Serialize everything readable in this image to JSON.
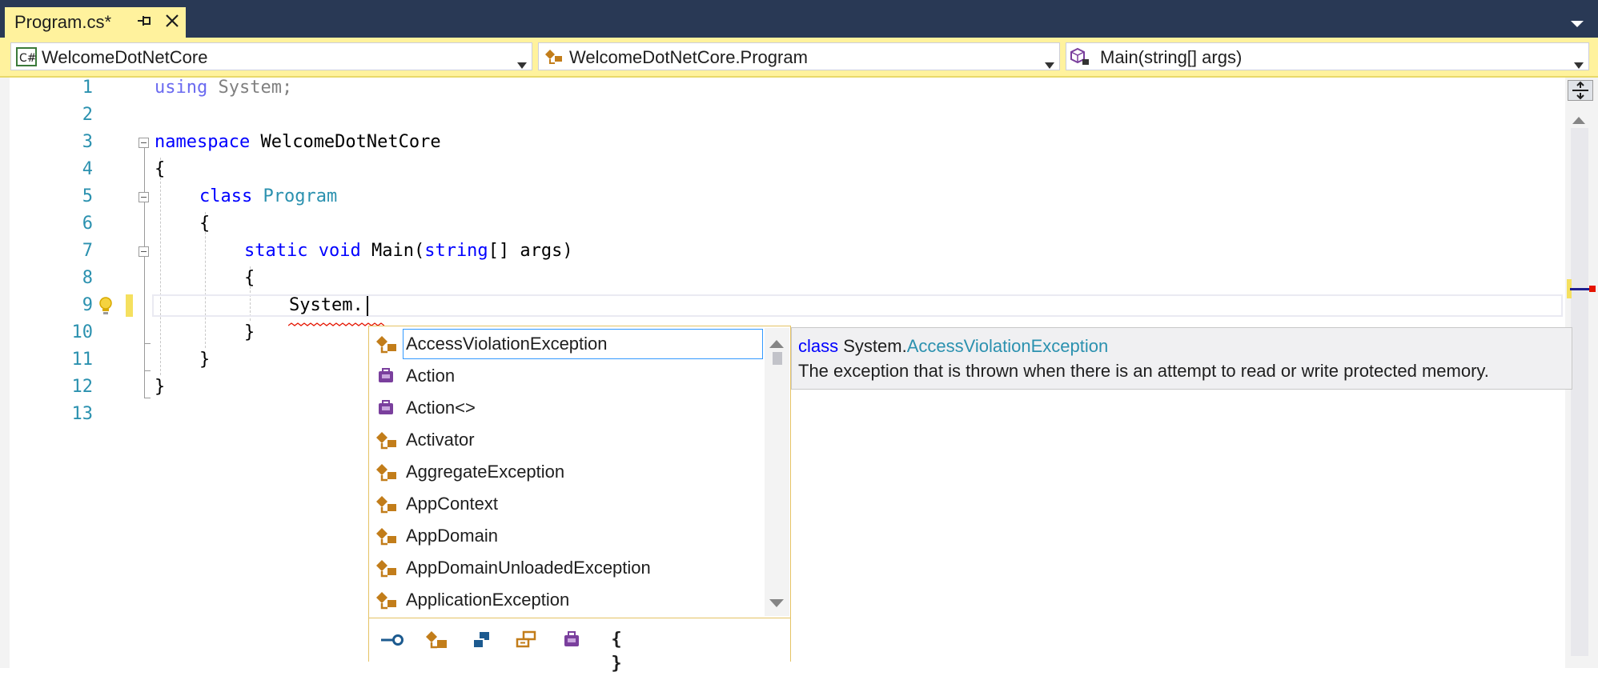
{
  "tab": {
    "title": "Program.cs*",
    "pin_icon": "pin-icon",
    "close_icon": "close-icon"
  },
  "navbar": {
    "project": "WelcomeDotNetCore",
    "type": "WelcomeDotNetCore.Program",
    "member": "Main(string[] args)"
  },
  "code": {
    "line_numbers": [
      "1",
      "2",
      "3",
      "4",
      "5",
      "6",
      "7",
      "8",
      "9",
      "10",
      "11",
      "12",
      "13"
    ],
    "l1_kw": "using",
    "l1_rest": " System;",
    "l3_kw": "namespace",
    "l3_rest": " WelcomeDotNetCore",
    "brace_open": "{",
    "brace_close": "}",
    "l5_kw": "class",
    "l5_type": "Program",
    "l7_kw1": "static",
    "l7_kw2": "void",
    "l7_name": " Main(",
    "l7_kw3": "string",
    "l7_rest": "[] args)",
    "l9_text": "System."
  },
  "completion": {
    "items": [
      {
        "label": "AccessViolationException",
        "icon": "class-icon"
      },
      {
        "label": "Action",
        "icon": "delegate-icon"
      },
      {
        "label": "Action<>",
        "icon": "delegate-icon"
      },
      {
        "label": "Activator",
        "icon": "class-icon"
      },
      {
        "label": "AggregateException",
        "icon": "class-icon"
      },
      {
        "label": "AppContext",
        "icon": "class-icon"
      },
      {
        "label": "AppDomain",
        "icon": "class-icon"
      },
      {
        "label": "AppDomainUnloadedException",
        "icon": "class-icon"
      },
      {
        "label": "ApplicationException",
        "icon": "class-icon"
      }
    ],
    "selected_index": 0,
    "filters": [
      "interface-filter-icon",
      "class-filter-icon",
      "structure-filter-icon",
      "enum-filter-icon",
      "delegate-filter-icon",
      "namespace-filter-icon"
    ],
    "namespace_filter_glyph": "{ }"
  },
  "quickinfo": {
    "kind": "class",
    "namespace": "System.",
    "type_name": "AccessViolationException",
    "description": "The exception that is thrown when there is an attempt to read or write protected memory."
  },
  "colors": {
    "keyword": "#0000ff",
    "type": "#2b91af",
    "tab_highlight": "#fff29d",
    "chrome": "#293955",
    "class_icon": "#c27d1a",
    "delegate_icon": "#7a3f9d"
  }
}
